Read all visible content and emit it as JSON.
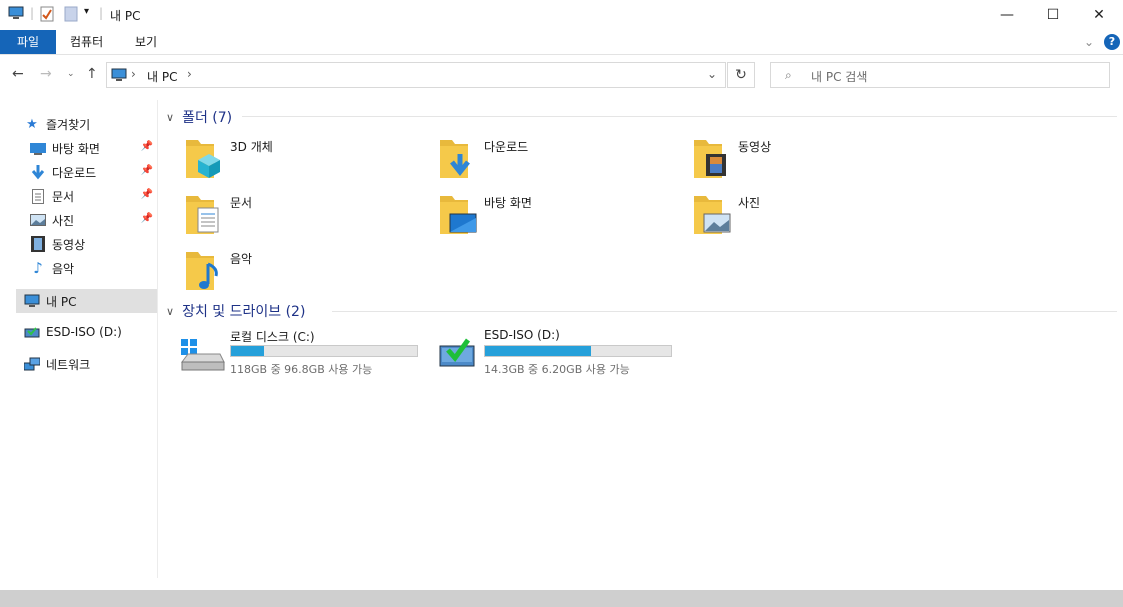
{
  "window": {
    "title": "내 PC",
    "controls": {
      "minimize": "—",
      "maximize": "☐",
      "close": "✕"
    }
  },
  "ribbon": {
    "tabs": [
      "파일",
      "컴퓨터",
      "보기"
    ],
    "help": "?"
  },
  "address": {
    "path_label": "내 PC",
    "search_placeholder": "내 PC 검색"
  },
  "sidebar": {
    "quick_access": "즐겨찾기",
    "items": [
      {
        "label": "바탕 화면",
        "icon": "desktop-icon",
        "pinned": true
      },
      {
        "label": "다운로드",
        "icon": "download-icon",
        "pinned": true
      },
      {
        "label": "문서",
        "icon": "document-icon",
        "pinned": true
      },
      {
        "label": "사진",
        "icon": "picture-icon",
        "pinned": true
      },
      {
        "label": "동영상",
        "icon": "video-icon",
        "pinned": false
      },
      {
        "label": "음악",
        "icon": "music-icon",
        "pinned": false
      }
    ],
    "this_pc": "내 PC",
    "drive": "ESD-ISO (D:)",
    "network": "네트워크"
  },
  "folders_group": {
    "title": "폴더 (7)",
    "items": [
      {
        "label": "3D 개체",
        "icon": "3d-objects-icon"
      },
      {
        "label": "다운로드",
        "icon": "download-icon"
      },
      {
        "label": "동영상",
        "icon": "video-icon"
      },
      {
        "label": "문서",
        "icon": "document-icon"
      },
      {
        "label": "바탕 화면",
        "icon": "desktop-icon"
      },
      {
        "label": "사진",
        "icon": "picture-icon"
      },
      {
        "label": "음악",
        "icon": "music-icon"
      }
    ]
  },
  "drives_group": {
    "title": "장치 및 드라이브 (2)",
    "items": [
      {
        "label": "로컬 디스크 (C:)",
        "free": "118GB 중 96.8GB 사용 가능",
        "used_fraction": 0.18,
        "icon": "windows-drive-icon"
      },
      {
        "label": "ESD-ISO (D:)",
        "free": "14.3GB 중 6.20GB 사용 가능",
        "used_fraction": 0.57,
        "icon": "usb-drive-icon"
      }
    ]
  },
  "colors": {
    "accent": "#1565b8",
    "group_title": "#1e3287",
    "bar_fill": "#26a0da",
    "folder": "#f5c94a"
  }
}
